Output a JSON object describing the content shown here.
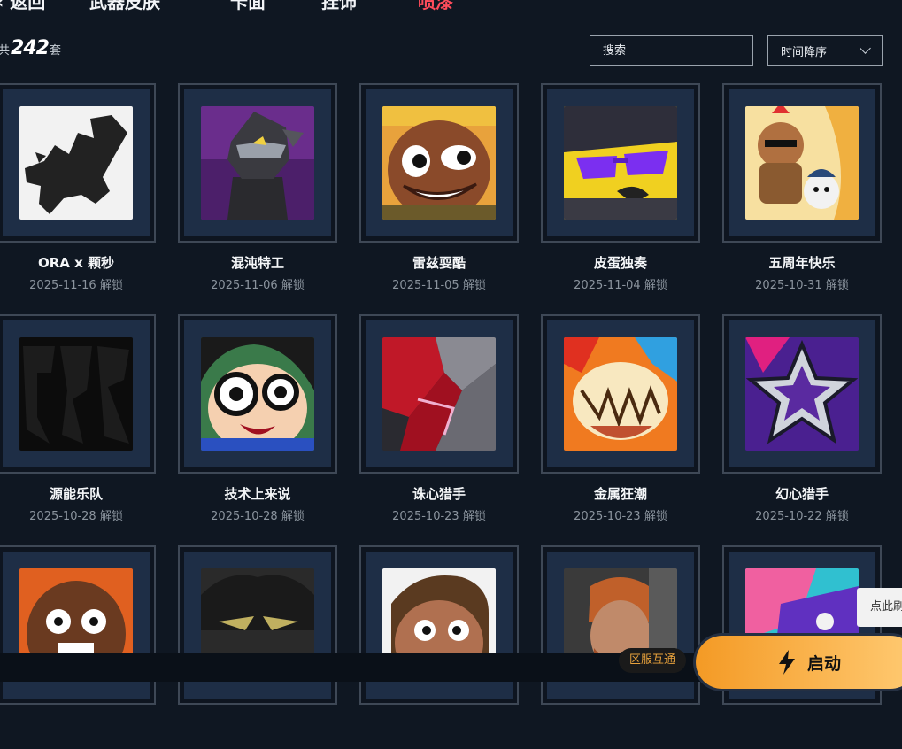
{
  "nav": {
    "back": "返回",
    "tabs": [
      "武器皮肤",
      "卡面",
      "挂饰",
      "喷漆"
    ],
    "active_tab": "喷漆"
  },
  "count": {
    "prefix": "共",
    "value": "242",
    "suffix": "套"
  },
  "search": {
    "placeholder": "搜索"
  },
  "sort": {
    "selected": "时间降序"
  },
  "unlock_suffix": "解锁",
  "items": [
    {
      "name": "ORA x 颗秒",
      "date": "2025-11-16",
      "unlock": "2025-11-16 解锁"
    },
    {
      "name": "混沌特工",
      "date": "2025-11-06",
      "unlock": "2025-11-06 解锁"
    },
    {
      "name": "雷兹耍酷",
      "date": "2025-11-05",
      "unlock": "2025-11-05 解锁"
    },
    {
      "name": "皮蛋独奏",
      "date": "2025-11-04",
      "unlock": "2025-11-04 解锁"
    },
    {
      "name": "五周年快乐",
      "date": "2025-10-31",
      "unlock": "2025-10-31 解锁"
    },
    {
      "name": "源能乐队",
      "date": "2025-10-28",
      "unlock": "2025-10-28 解锁"
    },
    {
      "name": "技术上来说",
      "date": "2025-10-28",
      "unlock": "2025-10-28 解锁"
    },
    {
      "name": "诛心猎手",
      "date": "2025-10-23",
      "unlock": "2025-10-23 解锁"
    },
    {
      "name": "金属狂潮",
      "date": "2025-10-23",
      "unlock": "2025-10-23 解锁"
    },
    {
      "name": "幻心猎手",
      "date": "2025-10-22",
      "unlock": "2025-10-22 解锁"
    }
  ],
  "footer": {
    "server_tag": "区服互通",
    "launch": "启动",
    "tooltip": "点此刷"
  },
  "colors": {
    "accent_active": "#ff4c5b",
    "launch_gradient": [
      "#f49a25",
      "#ffca72"
    ],
    "card_inner": "#1e2e46"
  }
}
